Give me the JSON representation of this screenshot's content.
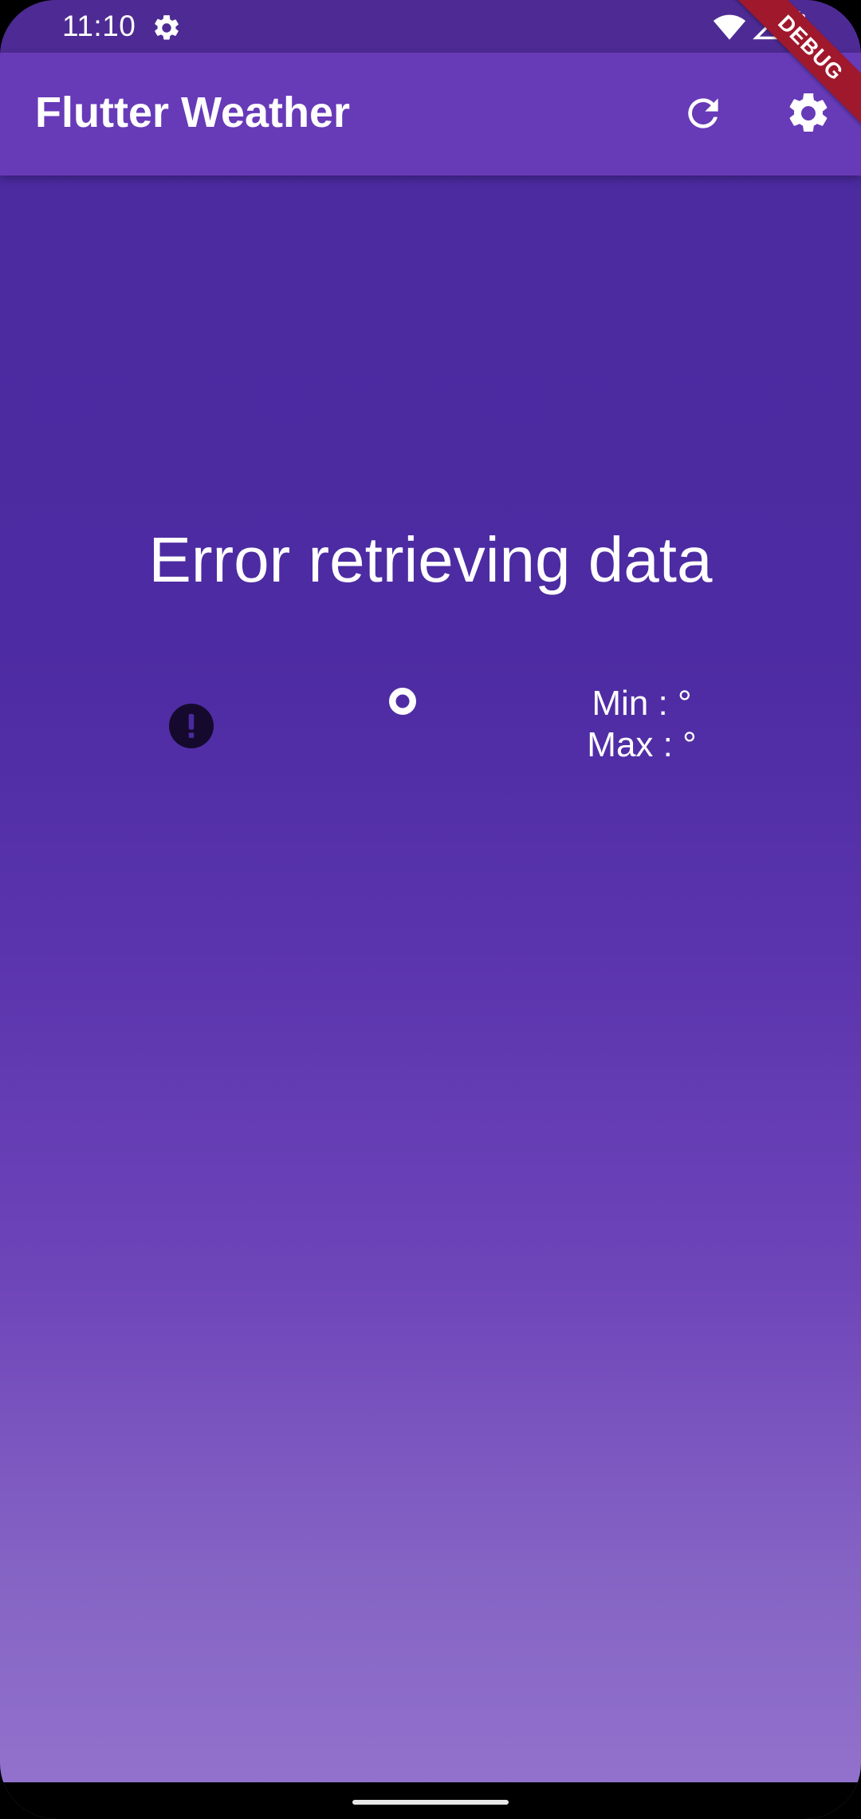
{
  "status_bar": {
    "time": "11:10",
    "icons": [
      "settings-icon",
      "wifi-icon",
      "signal-icon",
      "battery-icon"
    ]
  },
  "app_bar": {
    "title": "Flutter Weather",
    "actions": [
      "refresh-icon",
      "settings-icon"
    ]
  },
  "debug_banner": "DEBUG",
  "weather": {
    "message": "Error retrieving data",
    "status_icon": "error-icon",
    "temperature_icon": "degree-circle-icon",
    "min_label": "Min : °",
    "max_label": "Max : °"
  },
  "colors": {
    "app_bar": "#673ab7",
    "status_bar": "#4e2b94",
    "background_top": "#4b2a9f",
    "background_bottom": "#9474cd",
    "debug_ribbon": "#a0182c"
  }
}
